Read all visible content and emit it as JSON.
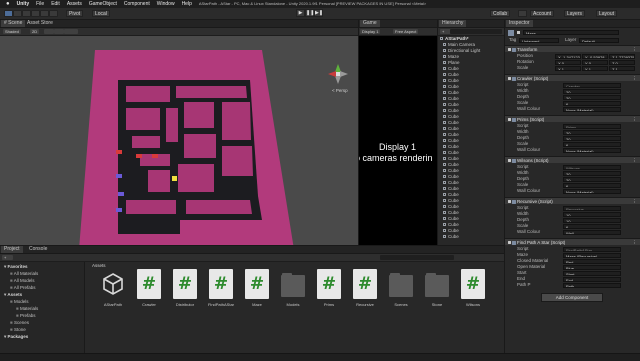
{
  "menubar": {
    "apple": "",
    "items": [
      "Unity",
      "File",
      "Edit",
      "Assets",
      "GameObject",
      "Component",
      "Window",
      "Help"
    ],
    "title": "AStarPath - AStar - PC, Mac & Linux Standalone - Unity 2020.1.9f1 Personal [PREVIEW PACKAGES IN USE] Personal <Metal>"
  },
  "toolbar": {
    "pivot": "Pivot",
    "local": "Local",
    "collab": "Collab",
    "account": "Account",
    "layers": "Layers",
    "layout": "Layout"
  },
  "scene": {
    "tabs": [
      "# Scene",
      "Asset Store"
    ],
    "shaded": "Shaded",
    "mode": "2D",
    "persp": "< Persp",
    "floor_color": "#b23a7c",
    "wall_color": "#1e1e22",
    "path_color": "#9a2f6a"
  },
  "game": {
    "tab": "Game",
    "display": "Display 1",
    "aspect": "Free Aspect",
    "msg_line1": "Display 1",
    "msg_line2": "o cameras renderin"
  },
  "hierarchy": {
    "tab": "Hierarchy",
    "search": "",
    "root": "AStarPath*",
    "items": [
      "Main Camera",
      "Directional Light",
      "Maze",
      "Plane",
      "Cube",
      "Cube",
      "Cube",
      "Cube",
      "Cube",
      "Cube",
      "Cube",
      "Cube",
      "Cube",
      "Cube",
      "Cube",
      "Cube",
      "Cube",
      "Cube",
      "Cube",
      "Cube",
      "Cube",
      "Cube",
      "Cube",
      "Cube",
      "Cube",
      "Cube",
      "Cube",
      "Cube",
      "Cube",
      "Cube",
      "Cube",
      "Cube",
      "Cube"
    ]
  },
  "inspector": {
    "tab": "Inspector",
    "object_name": "Maze",
    "tag_label": "Tag",
    "tag": "Untagged",
    "layer_label": "Layer",
    "layer": "Default",
    "transform": {
      "title": "Transform",
      "rows": [
        {
          "label": "Position",
          "x": "X -1.347123",
          "y": "Y -0.53978",
          "z": "Z 1.7729375"
        },
        {
          "label": "Rotation",
          "x": "X 0",
          "y": "Y 0",
          "z": "Z 0"
        },
        {
          "label": "Scale",
          "x": "X 1",
          "y": "Y 1",
          "z": "Z 1"
        }
      ]
    },
    "components": [
      {
        "title": "Crawler (Script)",
        "rows": [
          [
            "Script",
            "Crawler"
          ],
          [
            "Width",
            "20"
          ],
          [
            "Depth",
            "20"
          ],
          [
            "Scale",
            "6"
          ],
          [
            "Wall Colour",
            "None (Material)"
          ]
        ]
      },
      {
        "title": "Prims (Script)",
        "rows": [
          [
            "Script",
            "Prims"
          ],
          [
            "Width",
            "20"
          ],
          [
            "Depth",
            "20"
          ],
          [
            "Scale",
            "6"
          ],
          [
            "Wall Colour",
            "None (Material)"
          ]
        ]
      },
      {
        "title": "Wilsons (Script)",
        "rows": [
          [
            "Script",
            "Wilsons"
          ],
          [
            "Width",
            "20"
          ],
          [
            "Depth",
            "20"
          ],
          [
            "Scale",
            "6"
          ],
          [
            "Wall Colour",
            "None (Material)"
          ]
        ]
      },
      {
        "title": "Recursive (Script)",
        "rows": [
          [
            "Script",
            "Recursive"
          ],
          [
            "Width",
            "10"
          ],
          [
            "Depth",
            "10"
          ],
          [
            "Scale",
            "6"
          ],
          [
            "Wall Colour",
            "Wall"
          ]
        ]
      },
      {
        "title": "Find Path A Star (Script)",
        "rows": [
          [
            "Script",
            "FindPathAStar"
          ],
          [
            "Maze",
            "Maze (Recursive)"
          ],
          [
            "Closed Material",
            "Red"
          ],
          [
            "Open Material",
            "Blue"
          ],
          [
            "Start",
            "Start"
          ],
          [
            "End",
            "End"
          ],
          [
            "Path P",
            "Path"
          ]
        ]
      }
    ],
    "add_component": "Add Component"
  },
  "project": {
    "tabs": [
      "Project",
      "Console"
    ],
    "tree": [
      {
        "label": "Favorites",
        "bold": true,
        "indent": 0
      },
      {
        "label": "All Materials",
        "bold": false,
        "indent": 1
      },
      {
        "label": "All Models",
        "bold": false,
        "indent": 1
      },
      {
        "label": "All Prefabs",
        "bold": false,
        "indent": 1
      },
      {
        "label": "Assets",
        "bold": true,
        "indent": 0
      },
      {
        "label": "Models",
        "bold": false,
        "indent": 1
      },
      {
        "label": "Materials",
        "bold": false,
        "indent": 2
      },
      {
        "label": "Prefabs",
        "bold": false,
        "indent": 2
      },
      {
        "label": "Scenes",
        "bold": false,
        "indent": 1
      },
      {
        "label": "Stone",
        "bold": false,
        "indent": 1
      },
      {
        "label": "Packages",
        "bold": true,
        "indent": 0
      }
    ],
    "breadcrumb": "Assets",
    "assets": [
      {
        "label": "AStarPath",
        "type": "unity"
      },
      {
        "label": "Crawler",
        "type": "cs"
      },
      {
        "label": "Distributor",
        "type": "cs"
      },
      {
        "label": "FindPathAStar",
        "type": "cs"
      },
      {
        "label": "Maze",
        "type": "cs"
      },
      {
        "label": "Models",
        "type": "folder"
      },
      {
        "label": "Prims",
        "type": "cs"
      },
      {
        "label": "Recursive",
        "type": "cs"
      },
      {
        "label": "Scenes",
        "type": "folder"
      },
      {
        "label": "Stone",
        "type": "folder"
      },
      {
        "label": "Wilsons",
        "type": "cs"
      }
    ]
  }
}
